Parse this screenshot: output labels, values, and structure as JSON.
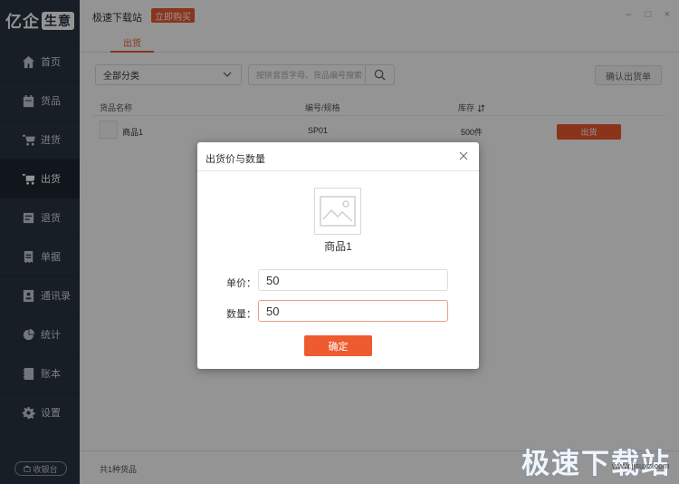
{
  "sidebar": {
    "logo": {
      "main": "亿企",
      "badge": "生意"
    },
    "items": [
      {
        "label": "首页",
        "icon": "home-icon"
      },
      {
        "label": "货品",
        "icon": "calendar-icon"
      },
      {
        "label": "进货",
        "icon": "cart-in-icon"
      },
      {
        "label": "出货",
        "icon": "cart-out-icon",
        "active": true
      },
      {
        "label": "退货",
        "icon": "return-icon"
      },
      {
        "label": "单据",
        "icon": "receipt-icon"
      },
      {
        "label": "通讯录",
        "icon": "contacts-icon"
      },
      {
        "label": "统计",
        "icon": "pie-chart-icon"
      },
      {
        "label": "账本",
        "icon": "ledger-icon"
      },
      {
        "label": "设置",
        "icon": "gear-icon"
      }
    ],
    "collect_button": "收银台"
  },
  "header": {
    "app_title": "极速下载站",
    "buy_button": "立即购买",
    "window_controls": [
      "–",
      "□",
      "×"
    ]
  },
  "tabs": {
    "active": "出货"
  },
  "filters": {
    "category_value": "全部分类",
    "search_placeholder": "按拼音首字母、货品编号搜索",
    "confirm_button": "确认出货单"
  },
  "table": {
    "headers": {
      "name": "货品名称",
      "code": "编号/规格",
      "stock": "库存"
    },
    "rows": [
      {
        "name": "商品1",
        "code": "SP01",
        "stock": "500件",
        "action": "出货"
      }
    ]
  },
  "footer": {
    "count_text": "共1种货品"
  },
  "modal": {
    "title": "出货价与数量",
    "product_name": "商品1",
    "price_label": "单价：",
    "price_value": "50",
    "qty_label": "数量：",
    "qty_value": "50",
    "ok_button": "确定"
  },
  "watermark": {
    "big": "极速下载站",
    "small": "www.jisuxz.com"
  },
  "colors": {
    "accent": "#ee5b2f",
    "sidebar_bg": "#293541",
    "sidebar_active": "#1d262f"
  }
}
